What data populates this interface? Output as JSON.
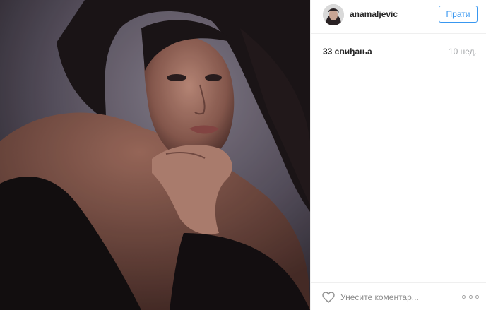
{
  "header": {
    "username": "anamaljevic",
    "follow_label": "Прати"
  },
  "post": {
    "likes": "33 свиђања",
    "age": "10 нед."
  },
  "footer": {
    "comment_placeholder": "Унесите коментар..."
  },
  "icons": {
    "like": "heart-icon",
    "more": "more-options-icon",
    "avatar": "profile-avatar"
  },
  "colors": {
    "accent": "#3897f0",
    "muted": "#a5a7aa",
    "divider": "#efefef"
  }
}
